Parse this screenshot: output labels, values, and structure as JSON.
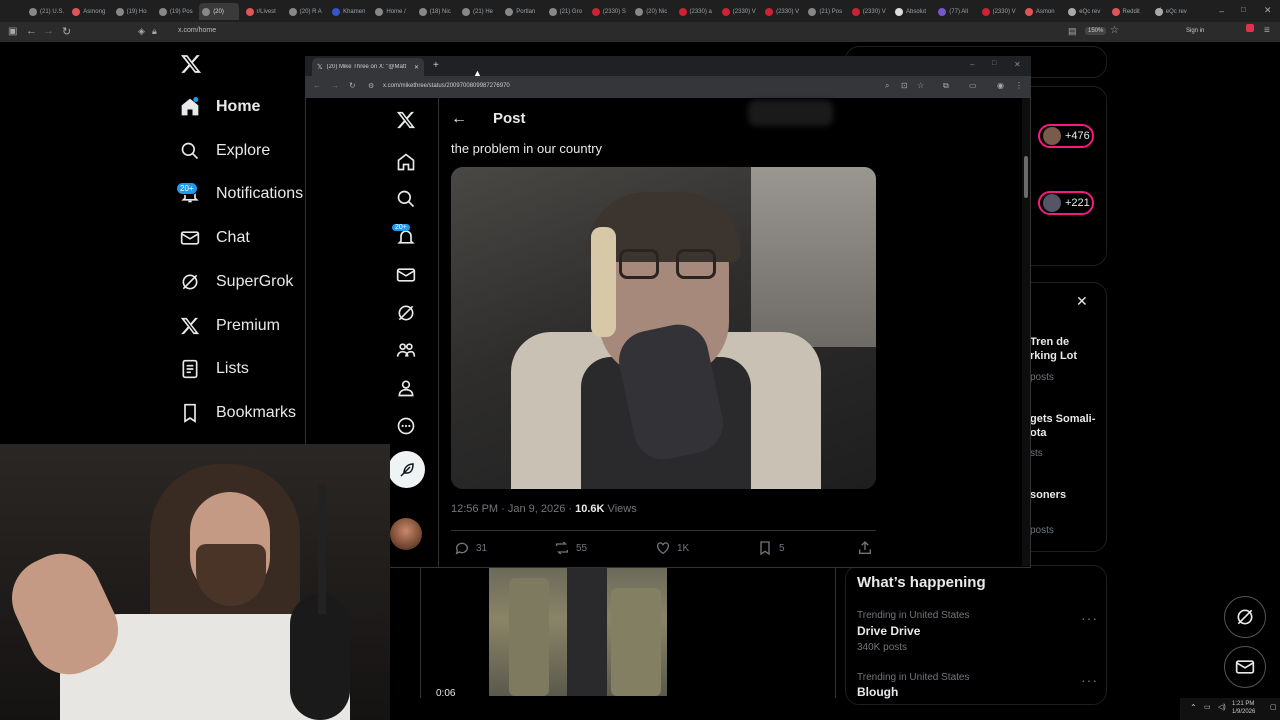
{
  "browser": {
    "tabs": [
      "(21) U.S.",
      "Asmong",
      "(19) Ho",
      "(19) Pos",
      "(20)",
      "r/Livest",
      "(20) R A",
      "Khamen",
      "Home /",
      "(18) Nic",
      "(21) He",
      "Portlan",
      "(21) Gro",
      "(2330) S",
      "(20) Nic",
      "(2330) a",
      "(2330) V",
      "(2330) V",
      "(21) Pos",
      "(2330) V",
      "Absolut",
      "(77) All",
      "(2330) V",
      "Asmon",
      "eQc rev",
      "Reddit",
      "eQc rev"
    ],
    "url": "x.com/home",
    "zoom": "150%",
    "sign_in": "Sign in"
  },
  "nav": {
    "items": [
      {
        "label": "Home",
        "icon": "home-icon"
      },
      {
        "label": "Explore",
        "icon": "search-icon"
      },
      {
        "label": "Notifications",
        "icon": "bell-icon"
      },
      {
        "label": "Chat",
        "icon": "mail-icon"
      },
      {
        "label": "SuperGrok",
        "icon": "grok-icon"
      },
      {
        "label": "Premium",
        "icon": "x-icon"
      },
      {
        "label": "Lists",
        "icon": "list-icon"
      },
      {
        "label": "Bookmarks",
        "icon": "bookmark-icon"
      }
    ],
    "notif_badge": "20+"
  },
  "popup": {
    "tab_title": "(20) Mike Three on X: \"@Matt",
    "url": "x.com/mikethree/status/2009700809987276970",
    "notif_badge": "20+",
    "header_title": "Post",
    "post_text": "the problem in our country",
    "meta_time": "12:56 PM · Jan 9, 2026 · ",
    "views_count": "10.6K",
    "views_label": " Views",
    "replies": "31",
    "reposts": "55",
    "likes": "1K",
    "bookmarks": "5"
  },
  "sidebar": {
    "pill1": "+476",
    "pill2": "+221",
    "frag1": [
      "Tren de",
      "rking Lot"
    ],
    "frag1_sub": "posts",
    "frag2": [
      "gets Somali-",
      "ota"
    ],
    "frag2_sub": "sts",
    "frag3": "soners",
    "frag3_sub": "posts",
    "whats_happening": "What’s happening",
    "trends": [
      {
        "context": "Trending in United States",
        "name": "Drive Drive",
        "count": "340K posts"
      },
      {
        "context": "Trending in United States",
        "name": "Blough",
        "count": ""
      }
    ]
  },
  "video": {
    "time": "0:06"
  },
  "taskbar": {
    "time": "1:21 PM",
    "date": "1/9/2026"
  }
}
